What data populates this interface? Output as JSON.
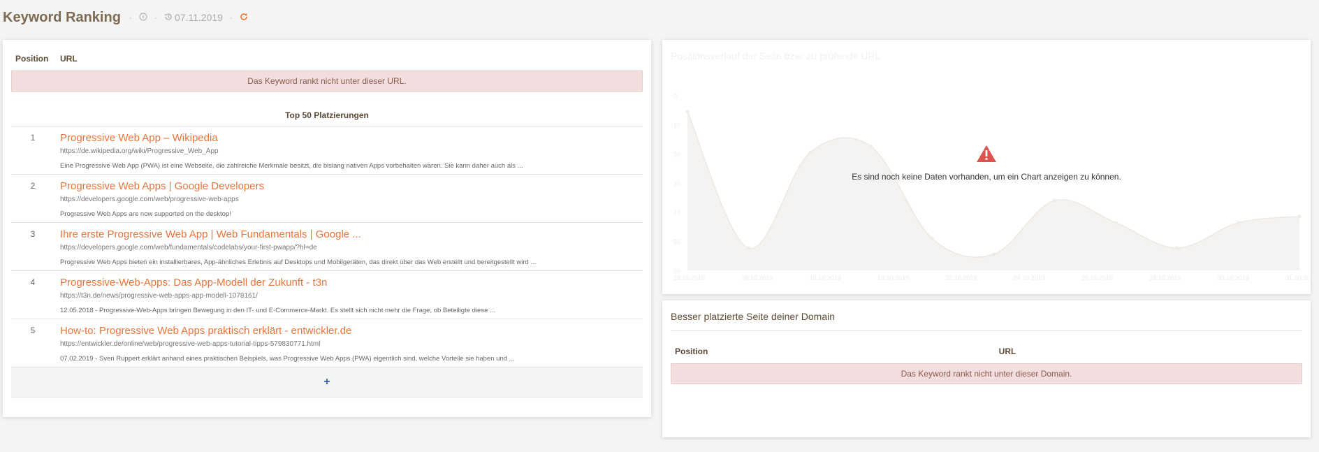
{
  "header": {
    "title": "Keyword Ranking",
    "sep": "·",
    "date": "07.11.2019"
  },
  "ranking": {
    "col_position": "Position",
    "col_url": "URL",
    "notice": "Das Keyword rankt nicht unter dieser URL.",
    "top50_title": "Top 50 Platzierungen",
    "results": [
      {
        "pos": "1",
        "title": "Progressive Web App – Wikipedia",
        "url": "https://de.wikipedia.org/wiki/Progressive_Web_App",
        "desc": "Eine Progressive Web App (PWA) ist eine Webseite, die zahlreiche Merkmale besitzt, die bislang nativen Apps vorbehalten waren. Sie kann daher auch als ..."
      },
      {
        "pos": "2",
        "title": "Progressive Web Apps | Google Developers",
        "url": "https://developers.google.com/web/progressive-web-apps",
        "desc": "Progressive Web Apps are now supported on the desktop!"
      },
      {
        "pos": "3",
        "title": "Ihre erste Progressive Web App | Web Fundamentals | Google ...",
        "url": "https://developers.google.com/web/fundamentals/codelabs/your-first-pwapp/?hl=de",
        "desc": "Progressive Web Apps bieten ein installierbares, App-ähnliches Erlebnis auf Desktops und Mobilgeräten, das direkt über das Web erstellt und bereitgestellt wird ..."
      },
      {
        "pos": "4",
        "title": "Progressive-Web-Apps: Das App-Modell der Zukunft - t3n",
        "url": "https://t3n.de/news/progressive-web-apps-app-modell-1078161/",
        "desc": "12.05.2018 - Progressive-Web-Apps bringen Bewegung in den IT- und E-Commerce-Markt. Es stellt sich nicht mehr die Frage, ob Beteiligte diese ..."
      },
      {
        "pos": "5",
        "title": "How-to: Progressive Web Apps praktisch erklärt - entwickler.de",
        "url": "https://entwickler.de/online/web/progressive-web-apps-tutorial-tipps-579830771.html",
        "desc": "07.02.2019 - Sven Ruppert erklärt anhand eines praktischen Beispiels, was Progressive Web Apps (PWA) eigentlich sind, welche Vorteile sie haben und ..."
      }
    ],
    "add_label": "+"
  },
  "chart_panel": {
    "title": "Positionsverlauf der Seite bzw. zu prüfende URL",
    "message": "Es sind noch keine Daten vorhanden, um ein Chart anzeigen zu können."
  },
  "chart_data": {
    "type": "area",
    "x": [
      "28.10.2019",
      "30.10.2019",
      "01.11.2019",
      "03.11.2019",
      "05.11.2019",
      "07.11.2019",
      "09.11.2019",
      "11.11.2019",
      "13.11.2019",
      "15.11.2019",
      "17.11.2019"
    ],
    "xticks": [
      "28.10.2019",
      "06.10.2019",
      "16.10.2019",
      "19.10.2019",
      "22.10.2019",
      "24.10.2019",
      "26.10.2019",
      "28.10.2019",
      "30.10.2019",
      "31.10.2019"
    ],
    "yticks": [
      "0",
      "10",
      "20",
      "30",
      "40",
      "50",
      "60"
    ],
    "series": [
      {
        "values": [
          5,
          48,
          18,
          16,
          45,
          50,
          33,
          40,
          48,
          40,
          38
        ]
      }
    ],
    "ylim": [
      0,
      55
    ],
    "inverted_y": true
  },
  "domain_panel": {
    "title": "Besser platzierte Seite deiner Domain",
    "col_position": "Position",
    "col_url": "URL",
    "notice": "Das Keyword rankt nicht unter dieser Domain."
  },
  "colors": {
    "accent": "#e8753a",
    "link_blue": "#3a5fa8",
    "warning": "#d9534f",
    "notice_bg": "#f2dede"
  }
}
